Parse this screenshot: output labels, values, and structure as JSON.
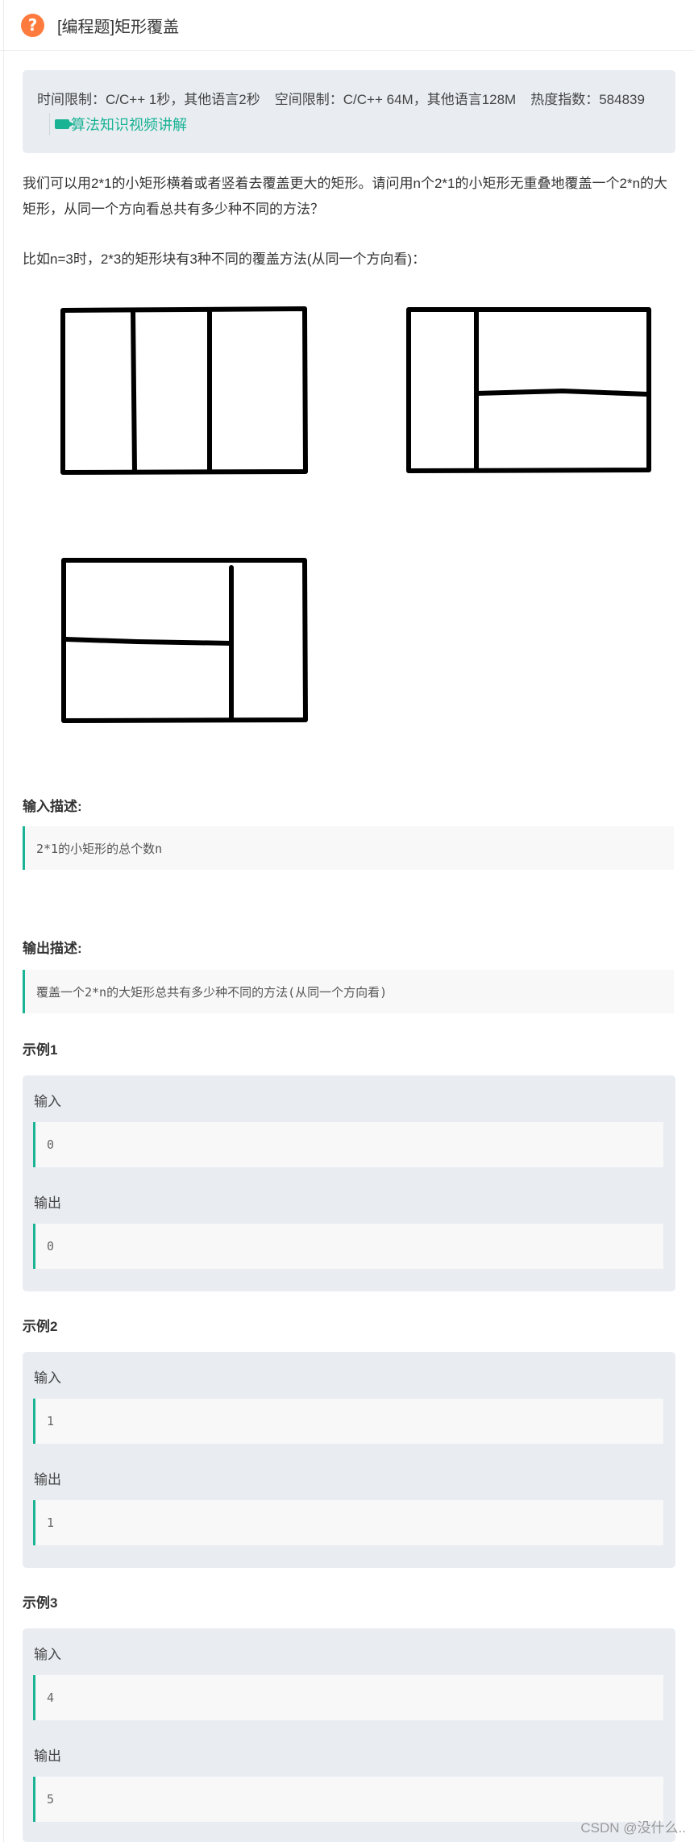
{
  "header": {
    "icon": "question-icon",
    "title": "[编程题]矩形覆盖"
  },
  "info": {
    "time_limit": "时间限制：C/C++ 1秒，其他语言2秒",
    "space_limit": "空间限制：C/C++ 64M，其他语言128M",
    "heat": "热度指数：584839",
    "video_link": "算法知识视频讲解",
    "accent": "#1ab394"
  },
  "description": {
    "paragraph": "我们可以用2*1的小矩形横着或者竖着去覆盖更大的矩形。请问用n个2*1的小矩形无重叠地覆盖一个2*n的大矩形，从同一个方向看总共有多少种不同的方法？",
    "example": "比如n=3时，2*3的矩形块有3种不同的覆盖方法(从同一个方向看)："
  },
  "input_desc": {
    "title": "输入描述:",
    "text": "2*1的小矩形的总个数n"
  },
  "output_desc": {
    "title": "输出描述:",
    "text": "覆盖一个2*n的大矩形总共有多少种不同的方法(从同一个方向看)"
  },
  "samples": [
    {
      "title": "示例1",
      "input_label": "输入",
      "input": "0",
      "output_label": "输出",
      "output": "0"
    },
    {
      "title": "示例2",
      "input_label": "输入",
      "input": "1",
      "output_label": "输出",
      "output": "1"
    },
    {
      "title": "示例3",
      "input_label": "输入",
      "input": "4",
      "output_label": "输出",
      "output": "5"
    }
  ],
  "watermark": "CSDN @没什么.."
}
